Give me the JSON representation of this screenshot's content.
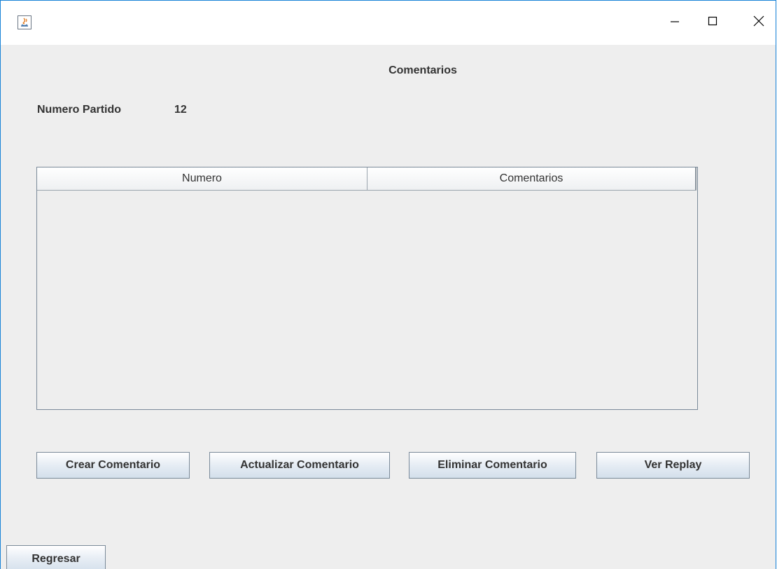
{
  "window": {
    "controls": {
      "minimize_icon": "minimize-icon",
      "maximize_icon": "maximize-icon",
      "close_icon": "close-icon"
    },
    "app_icon": "java-icon"
  },
  "header": {
    "title": "Comentarios"
  },
  "match": {
    "label": "Numero Partido",
    "value": "12"
  },
  "table": {
    "columns": [
      "Numero",
      "Comentarios"
    ],
    "rows": []
  },
  "actions": {
    "create": "Crear Comentario",
    "update": "Actualizar Comentario",
    "delete": "Eliminar Comentario",
    "replay": "Ver Replay",
    "back": "Regresar"
  },
  "colors": {
    "window_border": "#1883d7",
    "background": "#eeeeee"
  }
}
